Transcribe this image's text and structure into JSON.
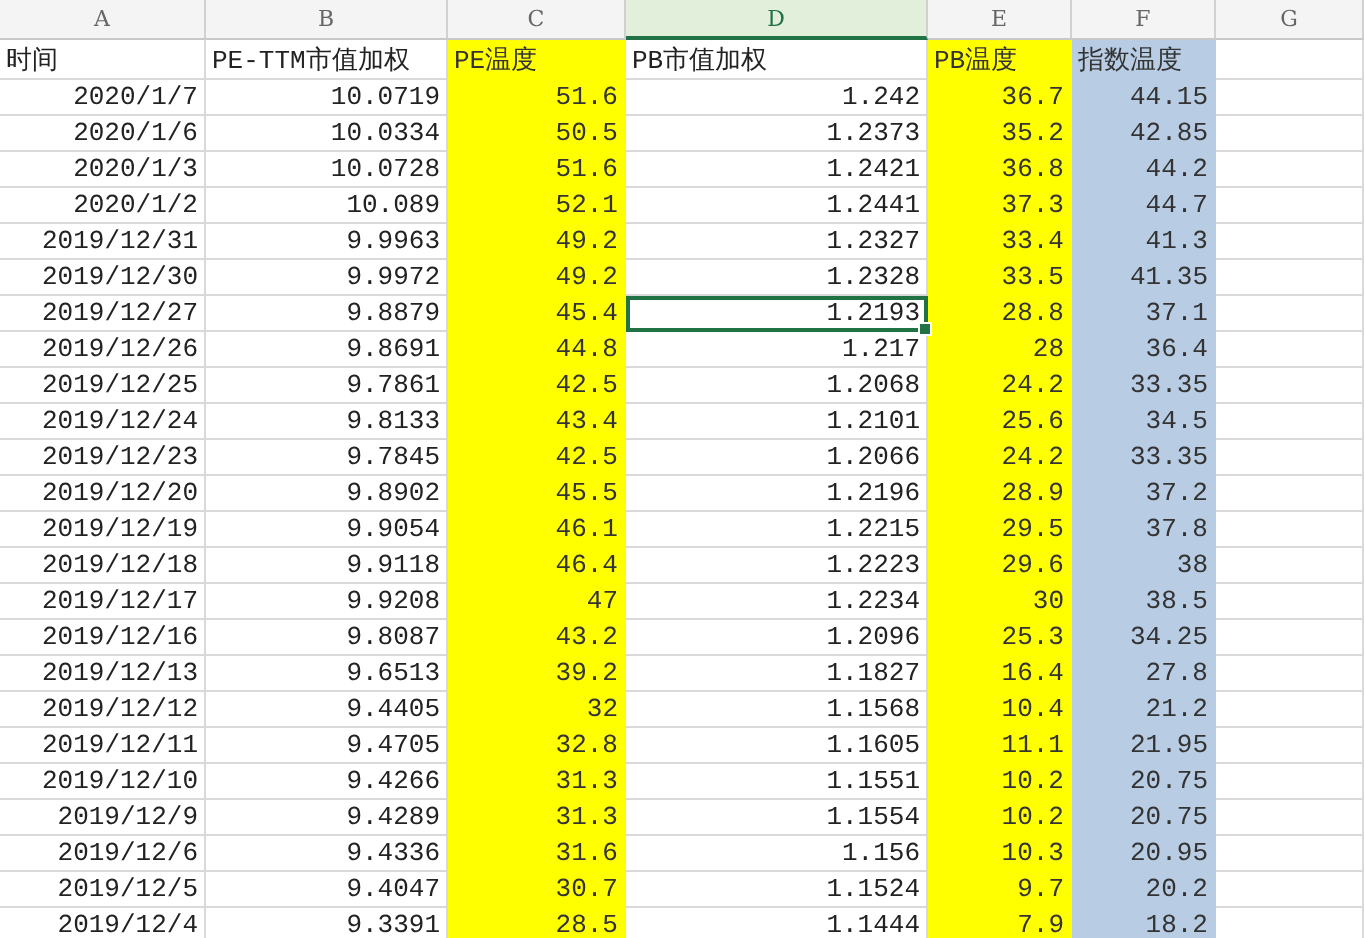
{
  "columns": [
    {
      "letter": "A",
      "title": "时间",
      "selected": false
    },
    {
      "letter": "B",
      "title": "PE-TTM市值加权",
      "selected": false
    },
    {
      "letter": "C",
      "title": "PE温度",
      "selected": false,
      "color": "#ffff00"
    },
    {
      "letter": "D",
      "title": "PB市值加权",
      "selected": true
    },
    {
      "letter": "E",
      "title": "PB温度",
      "selected": false,
      "color": "#ffff00"
    },
    {
      "letter": "F",
      "title": "指数温度",
      "selected": false,
      "color": "#b8cce4"
    },
    {
      "letter": "G",
      "selected": false
    }
  ],
  "rows": [
    {
      "values": [
        "2020/1/7",
        "10.0719",
        "51.6",
        "1.242",
        "36.7",
        "44.15"
      ],
      "selected": false
    },
    {
      "values": [
        "2020/1/6",
        "10.0334",
        "50.5",
        "1.2373",
        "35.2",
        "42.85"
      ],
      "selected": false
    },
    {
      "values": [
        "2020/1/3",
        "10.0728",
        "51.6",
        "1.2421",
        "36.8",
        "44.2"
      ],
      "selected": false
    },
    {
      "values": [
        "2020/1/2",
        "10.089",
        "52.1",
        "1.2441",
        "37.3",
        "44.7"
      ],
      "selected": false
    },
    {
      "values": [
        "2019/12/31",
        "9.9963",
        "49.2",
        "1.2327",
        "33.4",
        "41.3"
      ],
      "selected": false
    },
    {
      "values": [
        "2019/12/30",
        "9.9972",
        "49.2",
        "1.2328",
        "33.5",
        "41.35"
      ],
      "selected": false
    },
    {
      "values": [
        "2019/12/27",
        "9.8879",
        "45.4",
        "1.2193",
        "28.8",
        "37.1"
      ],
      "selected": true
    },
    {
      "values": [
        "2019/12/26",
        "9.8691",
        "44.8",
        "1.217",
        "28",
        "36.4"
      ],
      "selected": false
    },
    {
      "values": [
        "2019/12/25",
        "9.7861",
        "42.5",
        "1.2068",
        "24.2",
        "33.35"
      ],
      "selected": false
    },
    {
      "values": [
        "2019/12/24",
        "9.8133",
        "43.4",
        "1.2101",
        "25.6",
        "34.5"
      ],
      "selected": false
    },
    {
      "values": [
        "2019/12/23",
        "9.7845",
        "42.5",
        "1.2066",
        "24.2",
        "33.35"
      ],
      "selected": false
    },
    {
      "values": [
        "2019/12/20",
        "9.8902",
        "45.5",
        "1.2196",
        "28.9",
        "37.2"
      ],
      "selected": false
    },
    {
      "values": [
        "2019/12/19",
        "9.9054",
        "46.1",
        "1.2215",
        "29.5",
        "37.8"
      ],
      "selected": false
    },
    {
      "values": [
        "2019/12/18",
        "9.9118",
        "46.4",
        "1.2223",
        "29.6",
        "38"
      ],
      "selected": false
    },
    {
      "values": [
        "2019/12/17",
        "9.9208",
        "47",
        "1.2234",
        "30",
        "38.5"
      ],
      "selected": false
    },
    {
      "values": [
        "2019/12/16",
        "9.8087",
        "43.2",
        "1.2096",
        "25.3",
        "34.25"
      ],
      "selected": false
    },
    {
      "values": [
        "2019/12/13",
        "9.6513",
        "39.2",
        "1.1827",
        "16.4",
        "27.8"
      ],
      "selected": false
    },
    {
      "values": [
        "2019/12/12",
        "9.4405",
        "32",
        "1.1568",
        "10.4",
        "21.2"
      ],
      "selected": false
    },
    {
      "values": [
        "2019/12/11",
        "9.4705",
        "32.8",
        "1.1605",
        "11.1",
        "21.95"
      ],
      "selected": false
    },
    {
      "values": [
        "2019/12/10",
        "9.4266",
        "31.3",
        "1.1551",
        "10.2",
        "20.75"
      ],
      "selected": false
    },
    {
      "values": [
        "2019/12/9",
        "9.4289",
        "31.3",
        "1.1554",
        "10.2",
        "20.75"
      ],
      "selected": false
    },
    {
      "values": [
        "2019/12/6",
        "9.4336",
        "31.6",
        "1.156",
        "10.3",
        "20.95"
      ],
      "selected": false
    },
    {
      "values": [
        "2019/12/5",
        "9.4047",
        "30.7",
        "1.1524",
        "9.7",
        "20.2"
      ],
      "selected": false
    },
    {
      "values": [
        "2019/12/4",
        "9.3391",
        "28.5",
        "1.1444",
        "7.9",
        "18.2"
      ],
      "selected": false
    }
  ]
}
